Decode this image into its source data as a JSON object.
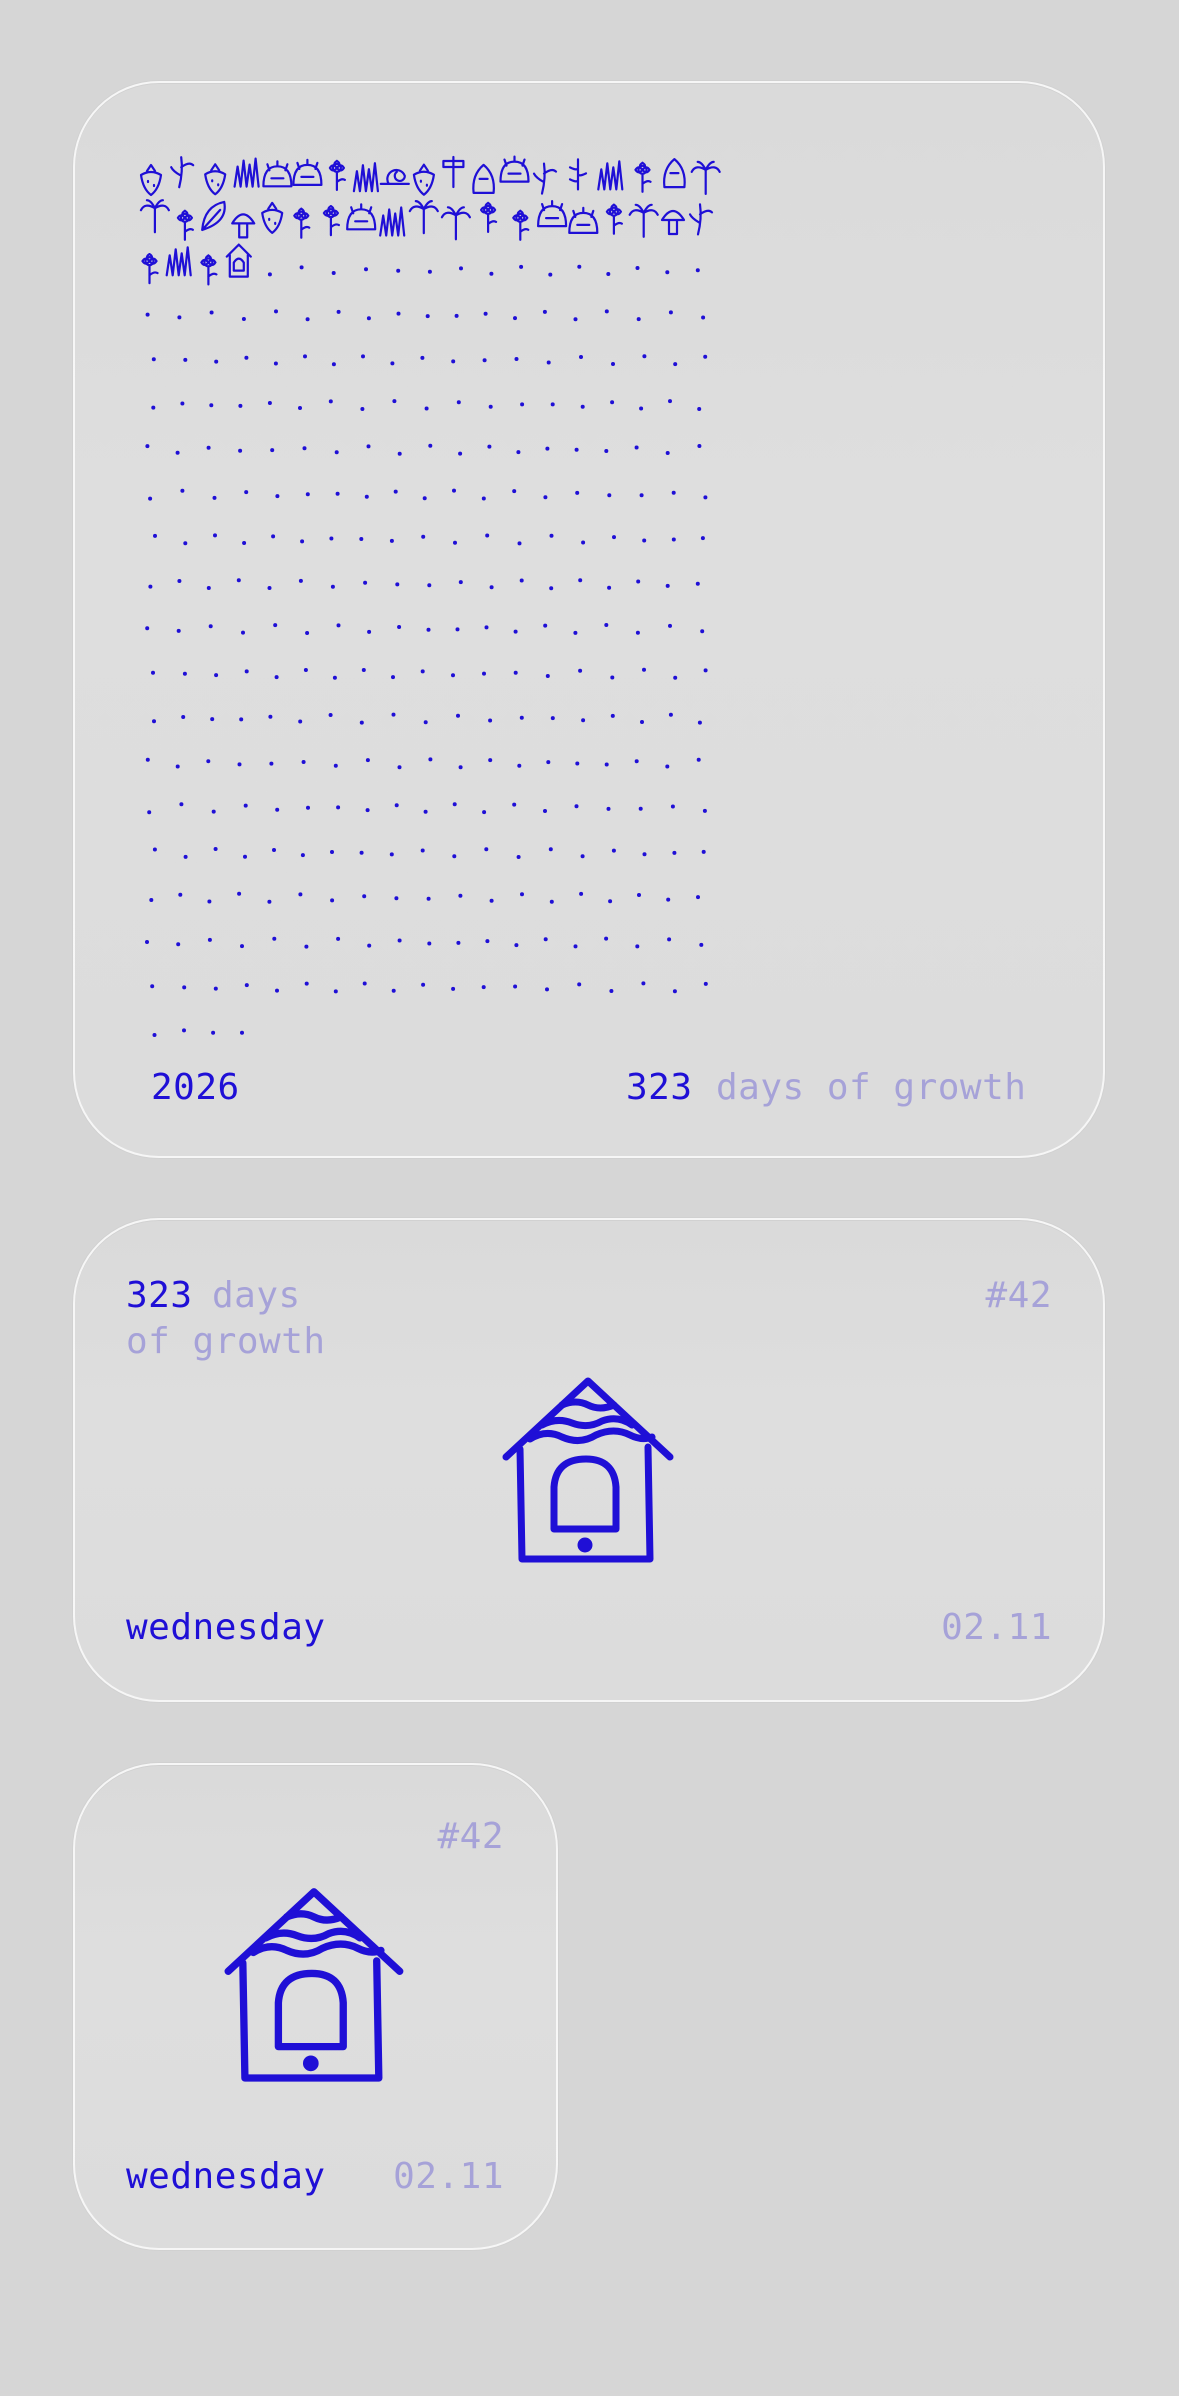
{
  "colors": {
    "accent": "#1f0fd6",
    "muted": "#a6a2d8",
    "background": "#d6d6d6",
    "widget": "#dddddd"
  },
  "large_widget": {
    "year": "2026",
    "days_count": "323",
    "days_label": "days of growth",
    "collection": {
      "grown_icons": [
        "strawberry-plant-icon",
        "sapling-icon",
        "berry-sprig-icon",
        "grass-icon",
        "hedgehog-icon",
        "bush-icon",
        "flower-icon",
        "reeds-icon",
        "snail-icon",
        "cherries-icon",
        "vine-icon",
        "pickle-icon",
        "hedgehog-icon",
        "monstera-icon",
        "signpost-icon",
        "grass-tuft-icon",
        "wildflowers-icon",
        "leaf-icon",
        "campfire-icon",
        "bamboo-icon",
        "flower-icon",
        "thistle-icon",
        "mushroom-icon",
        "strawberry-icon",
        "blossom-icon",
        "flower-icon",
        "pinecone-icon",
        "seaweed-icon",
        "palm-icon",
        "palm-icon",
        "poppy-icon",
        "flower-icon",
        "shrub-icon",
        "berry-bush-icon",
        "flower-icon",
        "cactus-icon",
        "mushrooms-icon",
        "sprout-icon",
        "sunflower-icon",
        "grass-icon",
        "rose-icon",
        "birdhouse-icon"
      ],
      "remaining_dots": 323
    }
  },
  "medium_widget": {
    "days_count": "323",
    "days_label_line1": "days",
    "days_label_line2": "of growth",
    "item_number": "#42",
    "weekday": "wednesday",
    "date": "02.11",
    "icon": "birdhouse-bell-icon"
  },
  "small_widget": {
    "item_number": "#42",
    "weekday": "wednesday",
    "date": "02.11",
    "icon": "birdhouse-bell-icon"
  }
}
